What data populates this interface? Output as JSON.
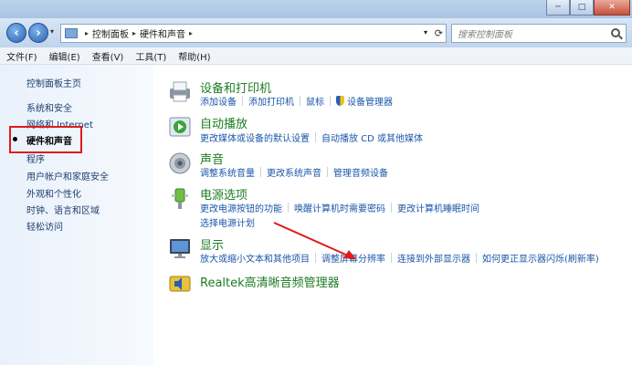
{
  "window": {
    "buttons": {
      "minimize": "─",
      "maximize": "□",
      "close": "✕"
    }
  },
  "address": {
    "back_icon": "back-arrow-icon",
    "forward_icon": "forward-arrow-icon",
    "crumbs": [
      "控制面板",
      "硬件和声音"
    ],
    "search_placeholder": "搜索控制面板"
  },
  "menu": [
    "文件(F)",
    "编辑(E)",
    "查看(V)",
    "工具(T)",
    "帮助(H)"
  ],
  "sidebar": {
    "items": [
      {
        "label": "控制面板主页"
      },
      {
        "label": "系统和安全"
      },
      {
        "label": "网络和 Internet"
      },
      {
        "label": "硬件和声音",
        "current": true
      },
      {
        "label": "程序"
      },
      {
        "label": "用户帐户和家庭安全"
      },
      {
        "label": "外观和个性化"
      },
      {
        "label": "时钟、语言和区域"
      },
      {
        "label": "轻松访问"
      }
    ]
  },
  "categories": [
    {
      "title": "设备和打印机",
      "icon": "printer-icon",
      "links": [
        "添加设备",
        "添加打印机",
        "鼠标",
        "设备管理器"
      ]
    },
    {
      "title": "自动播放",
      "icon": "autoplay-icon",
      "links": [
        "更改媒体或设备的默认设置",
        "自动播放 CD 或其他媒体"
      ]
    },
    {
      "title": "声音",
      "icon": "speaker-icon",
      "links": [
        "调整系统音量",
        "更改系统声音",
        "管理音频设备"
      ]
    },
    {
      "title": "电源选项",
      "icon": "power-plug-icon",
      "links": [
        "更改电源按钮的功能",
        "唤醒计算机时需要密码",
        "更改计算机睡眠时间"
      ],
      "links_row2": [
        "选择电源计划"
      ]
    },
    {
      "title": "显示",
      "icon": "monitor-icon",
      "links": [
        "放大或缩小文本和其他项目",
        "调整屏幕分辨率",
        "连接到外部显示器",
        "如何更正显示器闪烁(刷新率)"
      ]
    },
    {
      "title": "Realtek高清晰音频管理器",
      "icon": "realtek-audio-icon",
      "links": []
    }
  ],
  "colors": {
    "category_title": "#1c7c22",
    "link": "#1a56a8",
    "highlight": "#e01b1b"
  }
}
